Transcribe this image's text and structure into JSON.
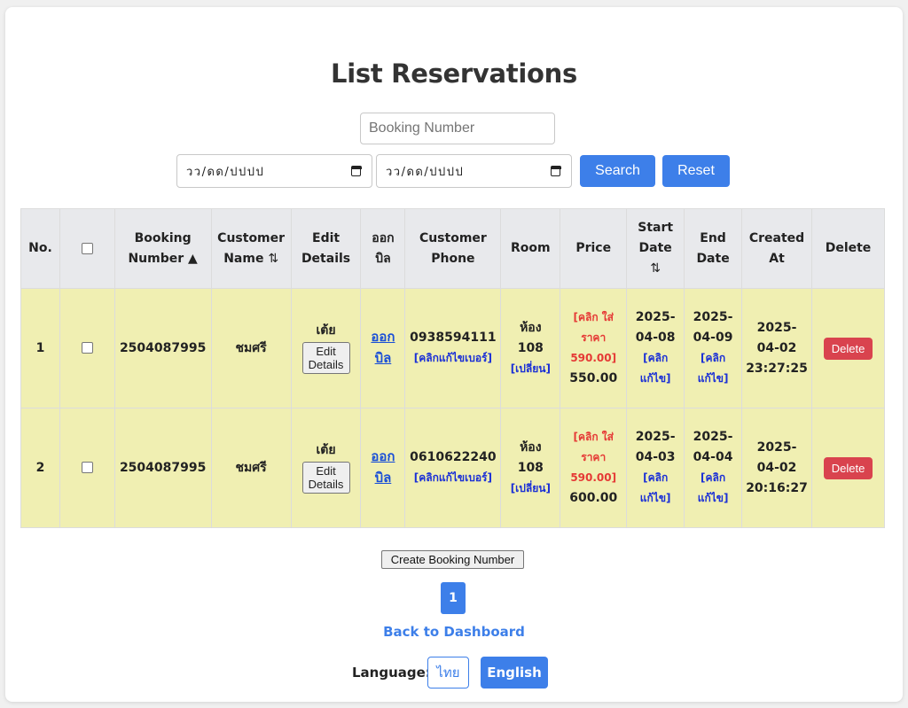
{
  "page": {
    "title": "List Reservations"
  },
  "filters": {
    "booking_placeholder": "Booking Number",
    "start_date_placeholder": "วว/ดด/ปปปป",
    "end_date_placeholder": "วว/ดด/ปปปป",
    "search_label": "Search",
    "reset_label": "Reset"
  },
  "table": {
    "headers": {
      "no": "No.",
      "booking_number": "Booking Number",
      "booking_sort": "▲",
      "customer_name": "Customer Name",
      "customer_sort": "⇅",
      "edit_details": "Edit Details",
      "bill": "ออกบิล",
      "customer_phone": "Customer Phone",
      "room": "Room",
      "price": "Price",
      "start_date": "Start Date",
      "start_sort": "⇅",
      "end_date": "End Date",
      "created_at": "Created At",
      "delete": "Delete"
    },
    "rows": [
      {
        "no": "1",
        "booking_number": "2504087995",
        "customer_name": "ชมศรี",
        "editor_name": "เต้ย",
        "edit_label": "Edit Details",
        "bill_label": "ออกบิล",
        "phone": "0938594111",
        "phone_edit": "[คลิกแก้ไขเบอร์]",
        "room": "ห้อง 108",
        "room_change": "[เปลี่ยน]",
        "price_edit": "[คลิก ใส่ราคา 590.00]",
        "price": "550.00",
        "start_date": "2025-04-08",
        "start_edit": "[คลิก แก้ไข]",
        "end_date": "2025-04-09",
        "end_edit": "[คลิก แก้ไข]",
        "created_date": "2025-04-02",
        "created_time": "23:27:25",
        "delete_label": "Delete"
      },
      {
        "no": "2",
        "booking_number": "2504087995",
        "customer_name": "ชมศรี",
        "editor_name": "เต้ย",
        "edit_label": "Edit Details",
        "bill_label": "ออกบิล",
        "phone": "0610622240",
        "phone_edit": "[คลิกแก้ไขเบอร์]",
        "room": "ห้อง 108",
        "room_change": "[เปลี่ยน]",
        "price_edit": "[คลิก ใส่ราคา 590.00]",
        "price": "600.00",
        "start_date": "2025-04-03",
        "start_edit": "[คลิก แก้ไข]",
        "end_date": "2025-04-04",
        "end_edit": "[คลิก แก้ไข]",
        "created_date": "2025-04-02",
        "created_time": "20:16:27",
        "delete_label": "Delete"
      }
    ]
  },
  "actions": {
    "create_booking_label": "Create Booking Number"
  },
  "pagination": {
    "current_page": "1"
  },
  "footer": {
    "back_label": "Back to Dashboard",
    "language_label": "Language:",
    "thai_label": "ไทย",
    "english_label": "English"
  },
  "colors": {
    "primary": "#3d7fe9",
    "danger": "#d9434e",
    "row_bg": "#f0efb2",
    "header_bg": "#e8e9ec"
  }
}
